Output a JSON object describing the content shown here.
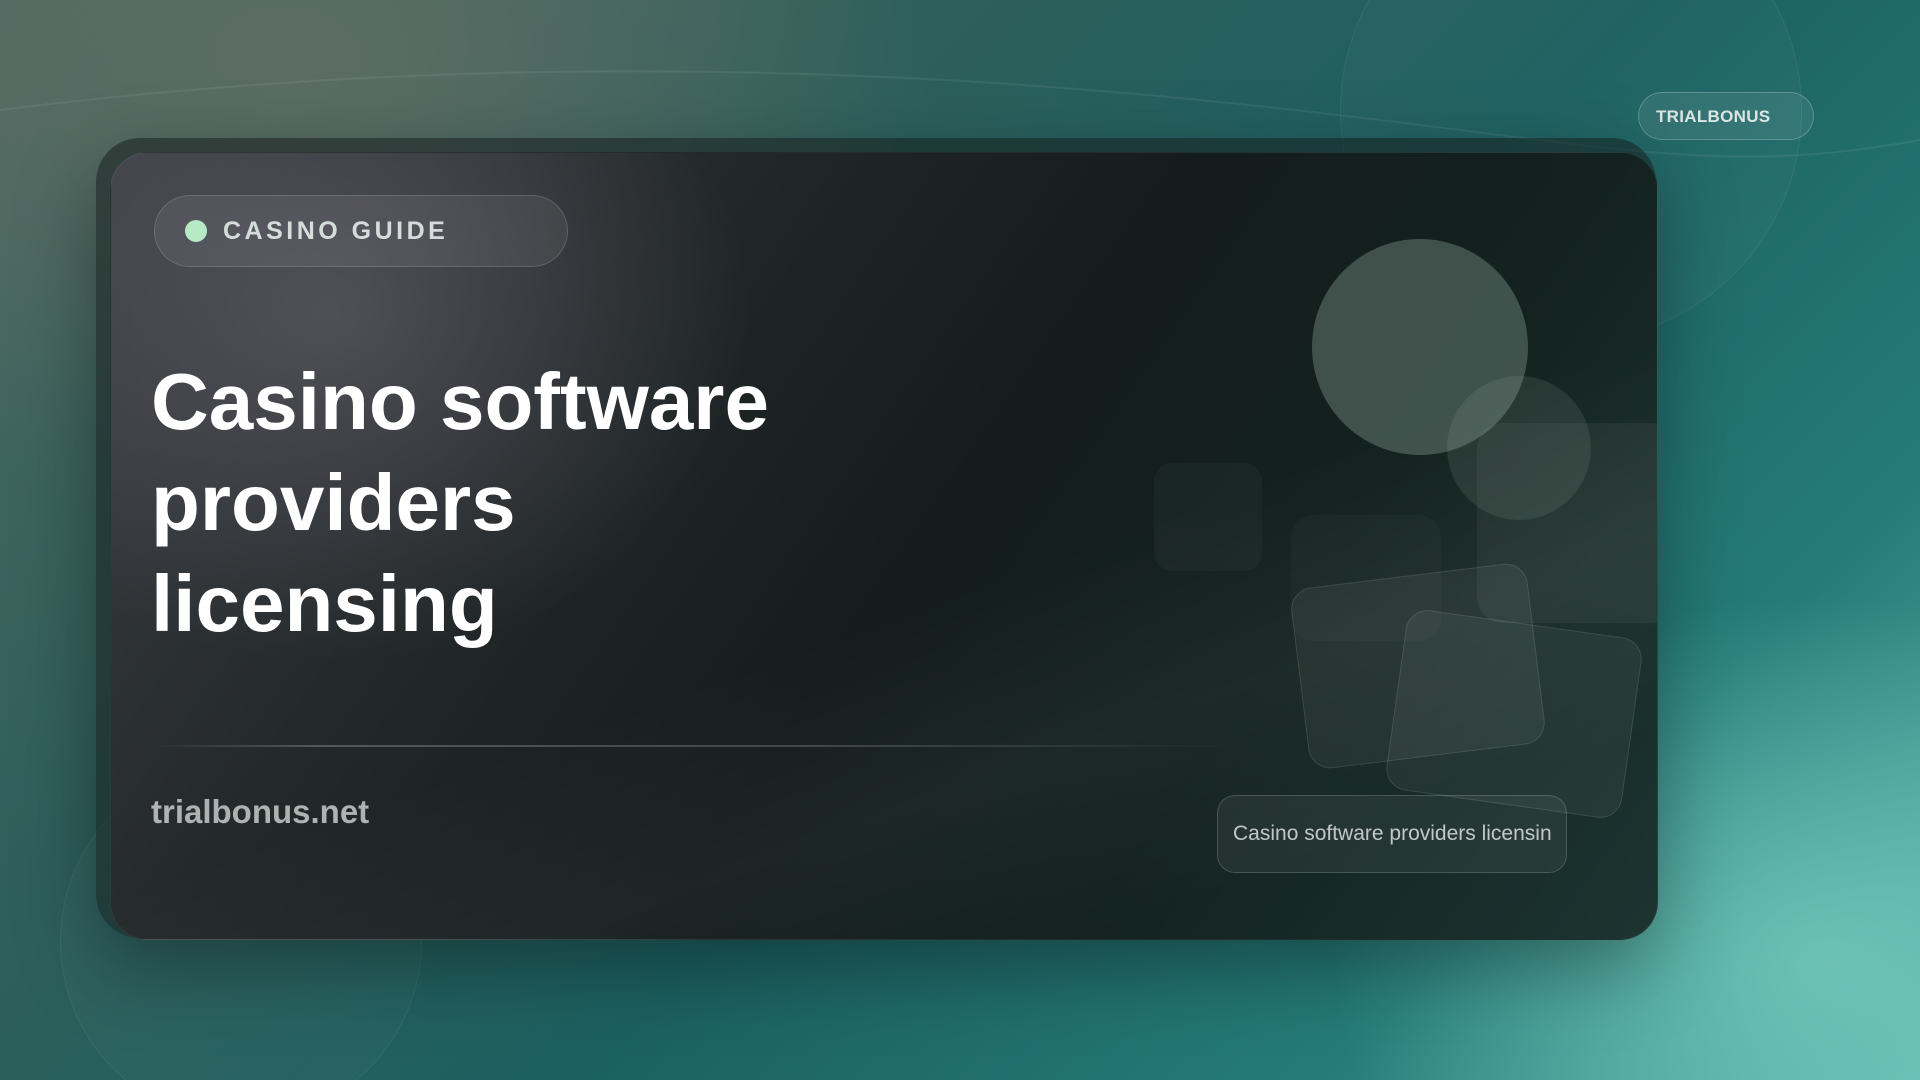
{
  "header": {
    "brand_label": "TRIALBONUS"
  },
  "card": {
    "tag": {
      "label": "CASINO GUIDE",
      "dot_color": "#b6eac5"
    },
    "title": "Casino software\nproviders\nlicensing",
    "site": "trialbonus.net",
    "caption": "Casino software providers licensin"
  },
  "colors": {
    "background_dark": "#1c6060",
    "background_light": "#5db5ab",
    "card_background": "#141c1c",
    "accent": "#b6eac5"
  }
}
